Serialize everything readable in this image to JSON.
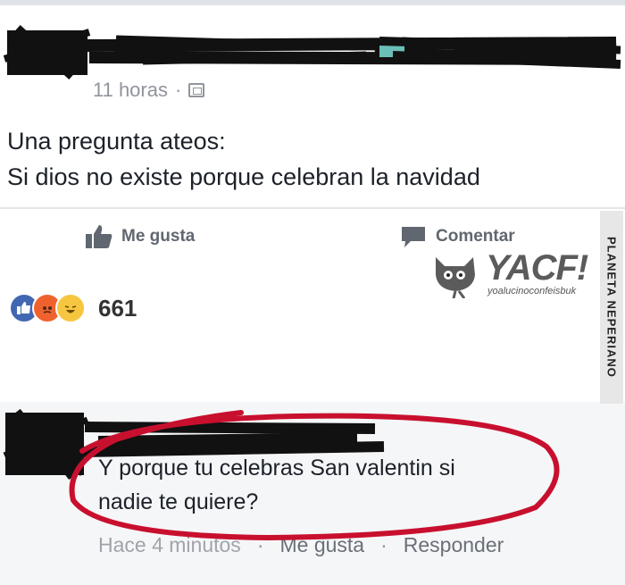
{
  "post": {
    "timestamp": "11 horas",
    "separator": "·",
    "privacy_icon": "globe-icon",
    "text_line1": "Una pregunta ateos:",
    "text_line2": "Si dios no existe porque celebran la navidad",
    "like_label": "Me gusta",
    "comment_label": "Comentar"
  },
  "reactions": {
    "types": [
      "like",
      "angry",
      "haha"
    ],
    "count": "661"
  },
  "comment": {
    "text_line1": "Y porque tu celebras San valentin si",
    "text_line2": "nadie te quiere?",
    "time": "Hace 4 minutos",
    "like_label": "Me gusta",
    "reply_label": "Responder",
    "separator": "·"
  },
  "watermark": {
    "side_text": "PLANETA NEPERIANO",
    "logo": "YACF!",
    "logo_sub": "yoalucinoconfeisbuk"
  },
  "colors": {
    "facebook_blue": "#4267b2",
    "angry_orange": "#f0622d",
    "haha_yellow": "#f7c640",
    "annotation_red": "#c8102e"
  }
}
